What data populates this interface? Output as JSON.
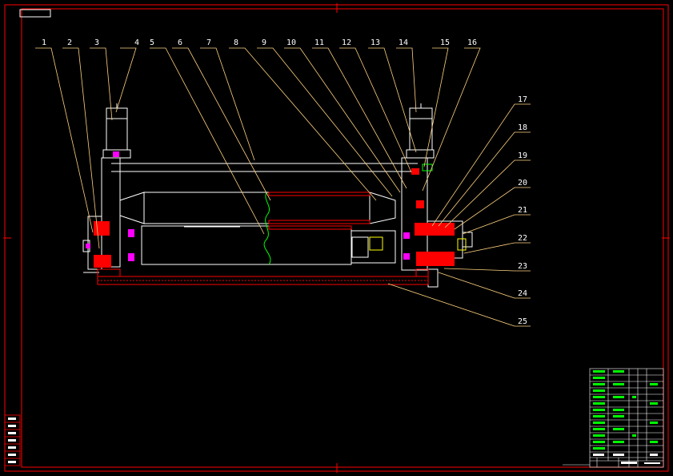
{
  "colors": {
    "frame": "#ff0000",
    "outline": "#ffffff",
    "leader": "#ffd27f",
    "section": "#ff0000",
    "table": "#00ff00",
    "accent": "#ff00ff",
    "highlight": "#ffff00",
    "break": "#00ff00"
  },
  "callouts_top": [
    "1",
    "2",
    "3",
    "4",
    "5",
    "6",
    "7",
    "8",
    "9",
    "10",
    "11",
    "12",
    "13",
    "14",
    "15",
    "16"
  ],
  "callouts_right": [
    "17",
    "18",
    "19",
    "20",
    "21",
    "22",
    "23",
    "24",
    "25"
  ]
}
